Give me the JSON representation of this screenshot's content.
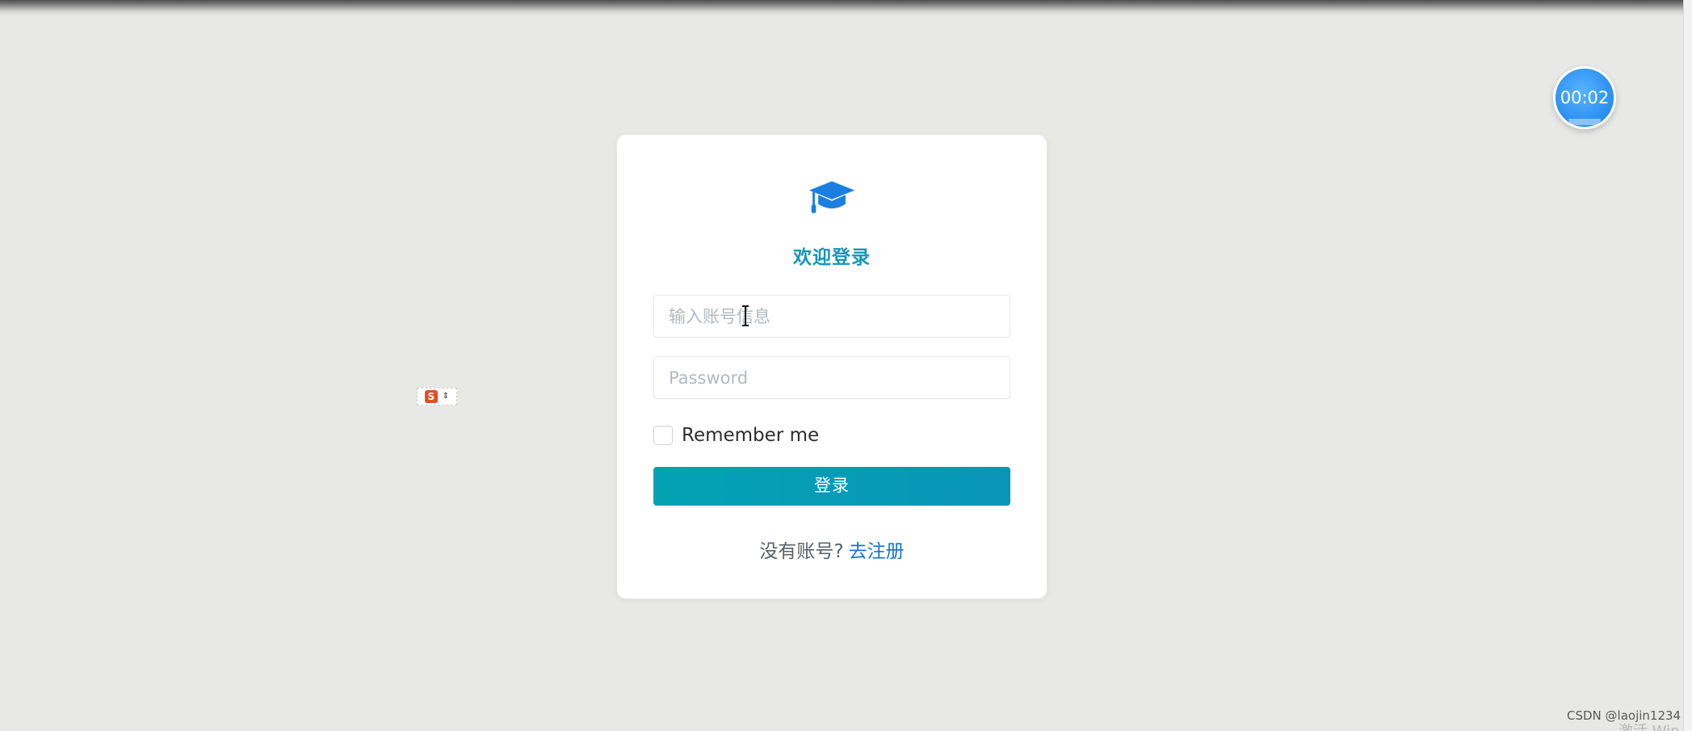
{
  "login": {
    "title": "欢迎登录",
    "account_placeholder": "输入账号信息",
    "password_placeholder": "Password",
    "remember_label": "Remember me",
    "remember_checked": false,
    "submit_label": "登录",
    "signup_prompt": "没有账号?",
    "signup_link": "去注册"
  },
  "timer": {
    "display": "00:02"
  },
  "toolbar": {
    "logo_letter": "S",
    "arrows": "⇕"
  },
  "watermark": {
    "text": "CSDN @laojin1234"
  },
  "system_overlay": {
    "text": "激活 Win"
  },
  "colors": {
    "page_background": "#e8e8e7",
    "card_background": "#ffffff",
    "title_color": "#1496b6",
    "button_gradient_start": "#03a2b3",
    "button_gradient_end": "#0995b8",
    "link_color": "#1473d6",
    "icon_color": "#1a7fe0",
    "timer_color": "#2f93f2"
  },
  "icons": {
    "brand": "graduation-cap-icon",
    "toolbar_logo": "s-logo-icon"
  }
}
